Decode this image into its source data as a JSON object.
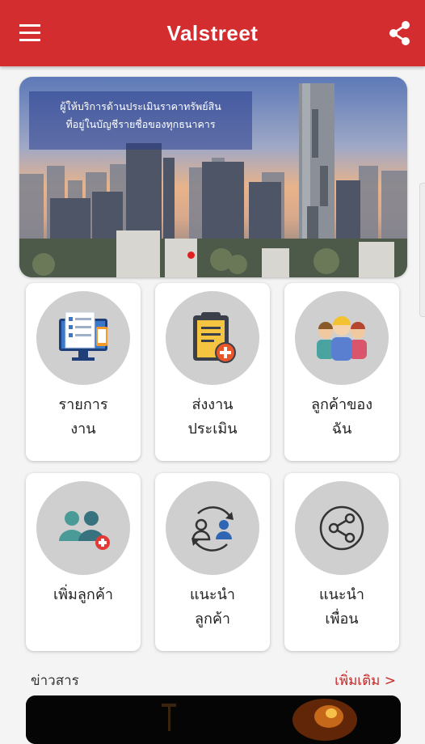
{
  "app": {
    "title": "Valstreet"
  },
  "banner": {
    "line1": "ผู้ให้บริการด้านประเมินราคาทรัพย์สิน",
    "line2": "ที่อยู่ในบัญชีรายชื่อของทุกธนาคาร"
  },
  "menu": [
    {
      "line1": "รายการ",
      "line2": "งาน",
      "icon": "task-list-icon"
    },
    {
      "line1": "ส่งงาน",
      "line2": "ประเมิน",
      "icon": "clipboard-add-icon"
    },
    {
      "line1": "ลูกค้าของ",
      "line2": "ฉัน",
      "icon": "customers-group-icon"
    },
    {
      "line1": "เพิ่มลูกค้า",
      "line2": "",
      "icon": "add-customer-icon"
    },
    {
      "line1": "แนะนำ",
      "line2": "ลูกค้า",
      "icon": "refer-customer-icon"
    },
    {
      "line1": "แนะนำ",
      "line2": "เพื่อน",
      "icon": "share-friend-icon"
    }
  ],
  "news": {
    "title": "ข่าวสาร",
    "more": "เพิ่มเติม >"
  },
  "colors": {
    "primary": "#d32d2f",
    "icon_circle": "#cfcfcf"
  }
}
